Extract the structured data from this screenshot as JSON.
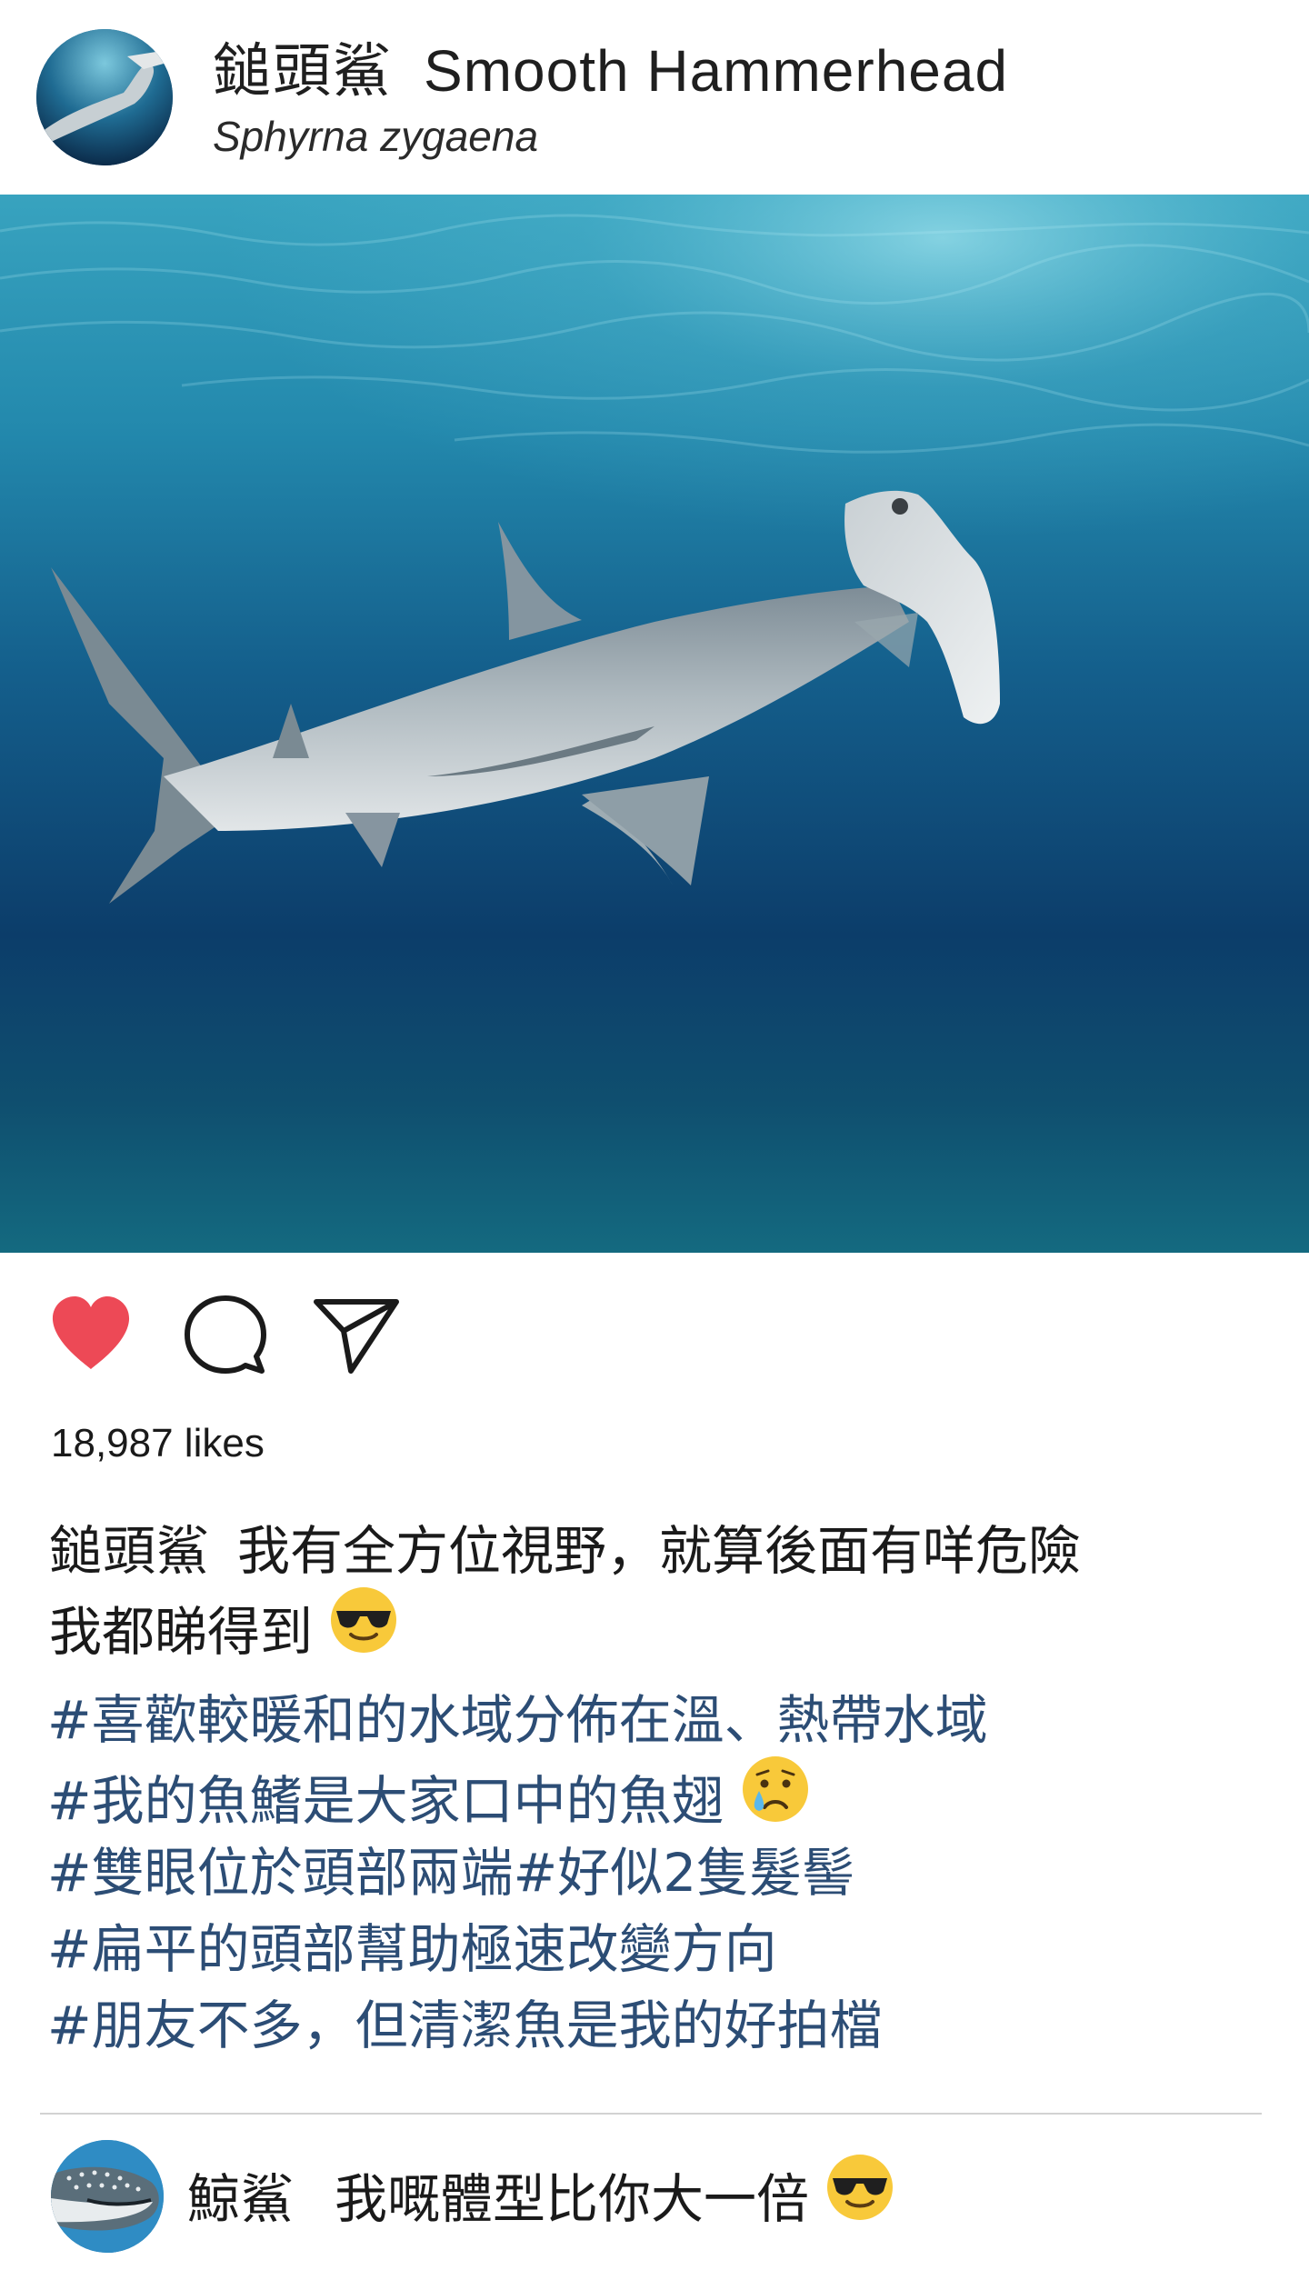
{
  "post": {
    "author_zh": "鎚頭鯊",
    "author_en": "Smooth Hammerhead",
    "scientific_name": "Sphyrna zygaena",
    "avatar_icon": "hammerhead-shark-avatar",
    "likes_text": "18,987 likes",
    "liked": true,
    "like_color": "#ed4956",
    "actions": {
      "like_icon": "heart-icon",
      "comment_icon": "comment-bubble-icon",
      "share_icon": "send-paper-plane-icon"
    },
    "caption": {
      "author": "鎚頭鯊",
      "line1": "我有全方位視野，就算後面有咩危險",
      "line2": "我都睇得到",
      "line2_emoji": "smiling-face-with-sunglasses"
    },
    "hashtags": [
      {
        "text": "#喜歡較暖和的水域分佈在溫、熱帶水域",
        "emoji": null
      },
      {
        "text": "#我的魚鰭是大家口中的魚翅",
        "emoji": "crying-face"
      },
      {
        "text": "#雙眼位於頭部兩端#好似2隻髮髻",
        "emoji": null
      },
      {
        "text": "#扁平的頭部幫助極速改變方向",
        "emoji": null
      },
      {
        "text": "#朋友不多，但清潔魚是我的好拍檔",
        "emoji": null
      }
    ],
    "hashtag_color": "#2c4d75"
  },
  "comment": {
    "author": "鯨鯊",
    "text": "我嘅體型比你大一倍",
    "emoji": "smiling-face-with-sunglasses",
    "avatar_icon": "whale-shark-avatar"
  }
}
